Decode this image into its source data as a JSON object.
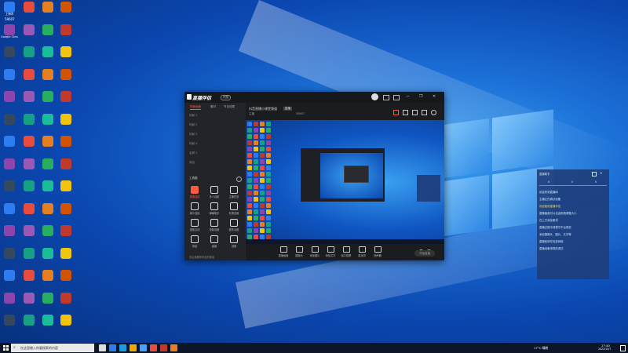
{
  "desktop": {
    "icon_labels": [
      "上海市",
      "",
      "",
      "",
      "Google Chrome",
      "",
      "",
      "",
      "",
      "",
      "",
      "",
      "",
      "",
      "",
      "",
      "",
      "",
      "",
      "",
      "",
      "",
      "",
      "",
      "",
      "",
      "",
      "",
      "",
      "",
      "",
      "",
      "",
      "",
      "",
      "",
      "",
      "",
      "",
      "",
      "",
      "",
      "",
      "",
      "",
      "",
      "",
      "",
      "",
      "",
      "",
      "",
      "",
      "",
      "",
      "",
      "",
      "",
      "",
      ""
    ],
    "user_badge": "58607"
  },
  "app": {
    "logo": "直播伴侣",
    "version_badge": "内测",
    "window_controls": [
      "—",
      "❐",
      "✕"
    ],
    "sidebar_tabs": [
      "场景画面",
      "素材",
      "节目效果"
    ],
    "scene_rows": [
      "场景 1",
      "场景 2",
      "场景 3",
      "场景 4",
      "全屏 1",
      "添加"
    ],
    "tools_header": "工具箱",
    "tools": [
      {
        "label": "直播连线",
        "hot": true
      },
      {
        "label": "多人连麦",
        "hot": false
      },
      {
        "label": "主播任务",
        "hot": false
      },
      {
        "label": "观众连线",
        "hot": false
      },
      {
        "label": "弹幕助手",
        "hot": false
      },
      {
        "label": "礼物设置",
        "hot": false
      },
      {
        "label": "语音互动",
        "hot": false
      },
      {
        "label": "录制设置",
        "hot": false
      },
      {
        "label": "更多功能",
        "hot": false
      },
      {
        "label": "商品",
        "hot": false
      },
      {
        "label": "画面",
        "hot": false
      },
      {
        "label": "设置",
        "hot": false
      }
    ],
    "sidebar_footer": "向主播推荐好友的链接",
    "stream_title": "抖音直播小课堂频道",
    "stream_tag": "直播",
    "stream_meta": "主播",
    "stream_extra": "58607",
    "bottom_buttons": [
      "直播画面",
      "摄像头",
      "添加图片",
      "添加文字",
      "窗口投屏",
      "麦克风",
      "扬声器"
    ],
    "go_live": "开始直播"
  },
  "panel": {
    "title": "直播助手",
    "counts": [
      "0",
      "0",
      "0"
    ],
    "lines": [
      {
        "text": "欢迎来到直播间",
        "yellow": false
      },
      {
        "text": "主播正在调试设备",
        "yellow": false
      },
      {
        "text": "欢迎使用直播伴侣",
        "yellow": true
      },
      {
        "text": "直播画面可以自由拖拽调整大小",
        "yellow": false
      },
      {
        "text": "在上方添加素材",
        "yellow": false
      },
      {
        "text": "直播过程中请遵守平台规范",
        "yellow": false
      },
      {
        "text": "添加摄像头、图片、文字等",
        "yellow": false
      },
      {
        "text": "直播前请先检查网络",
        "yellow": false
      },
      {
        "text": "直播设备请提前调试",
        "yellow": false
      }
    ]
  },
  "taskbar": {
    "search_placeholder": "在这里输入你要搜索的内容",
    "weather": "17°C 晴朗",
    "time": "17:40",
    "date": "2022/10/7"
  }
}
